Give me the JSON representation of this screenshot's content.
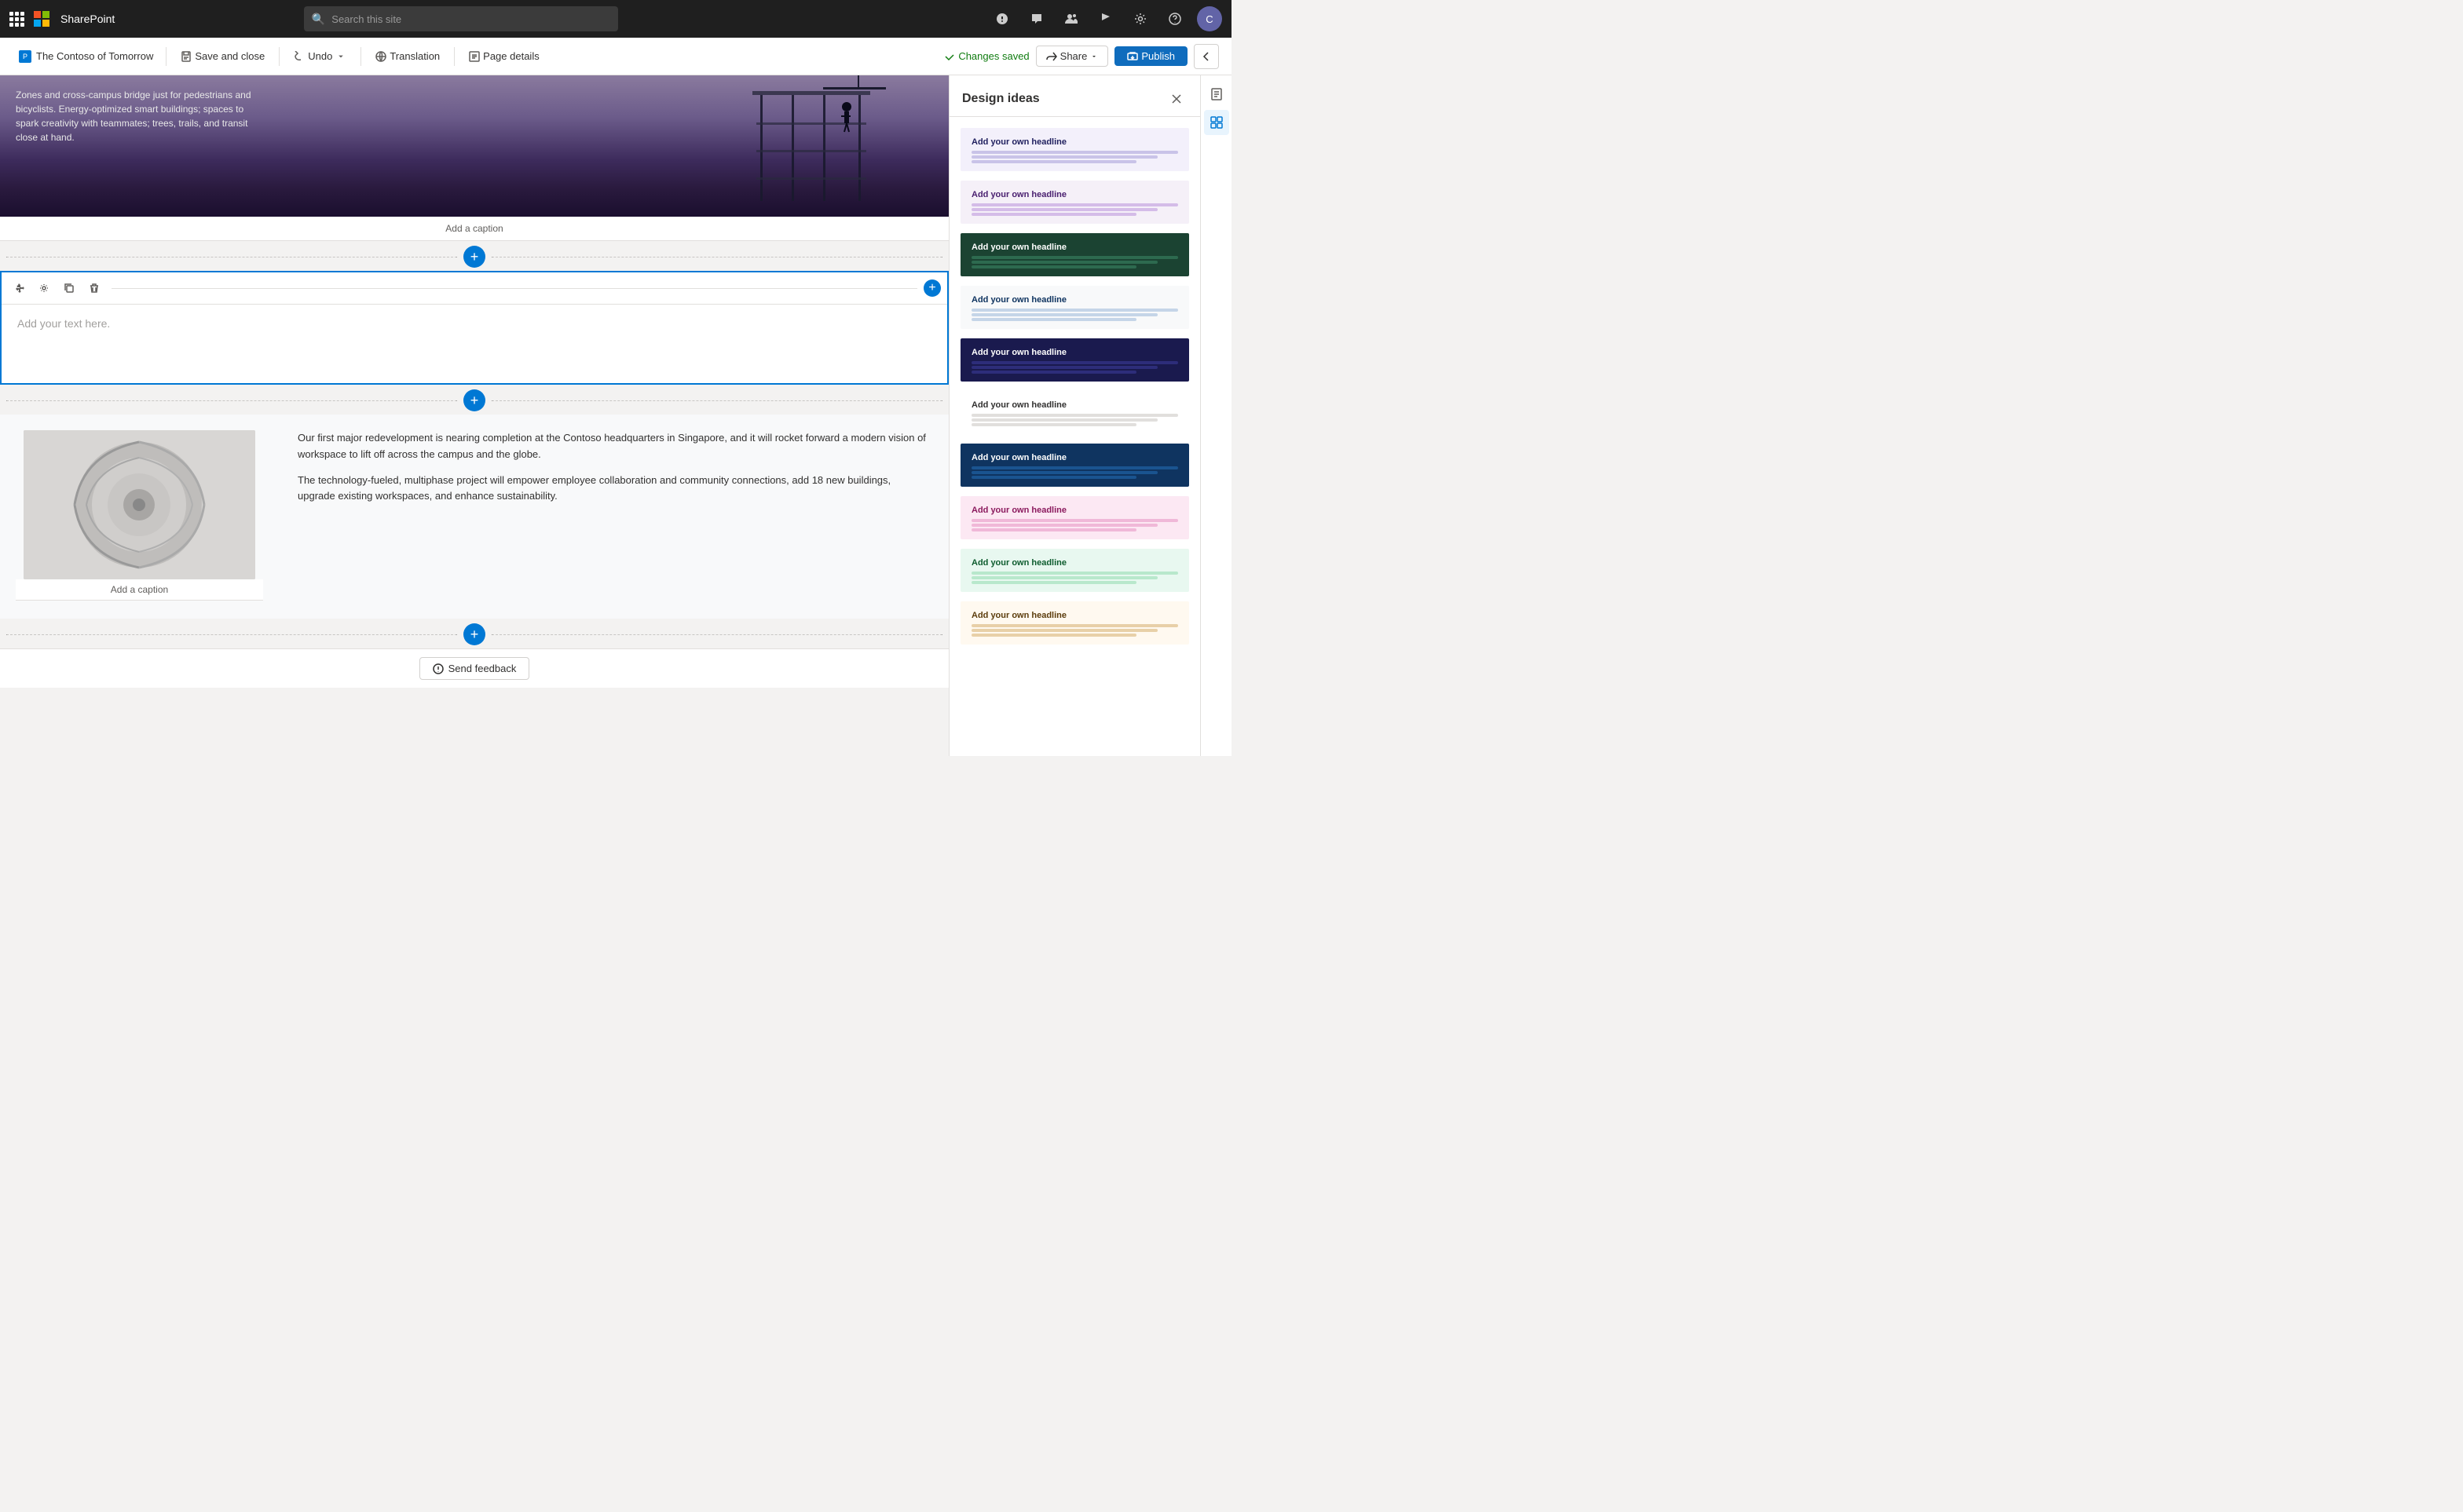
{
  "topbar": {
    "app_name": "SharePoint",
    "search_placeholder": "Search this site",
    "icons": [
      "grid-icon",
      "ms-logo",
      "share-icon",
      "comment-icon",
      "people-icon",
      "flag-icon",
      "settings-icon",
      "help-icon",
      "avatar"
    ]
  },
  "toolbar2": {
    "page_title": "The Contoso of Tomorrow",
    "save_close": "Save and close",
    "undo": "Undo",
    "translation": "Translation",
    "page_details": "Page details",
    "changes_saved": "Changes saved",
    "share": "Share",
    "publish": "Publish"
  },
  "hero": {
    "text": "Zones and cross-campus bridge just for pedestrians and bicyclists. Energy-optimized smart buildings; spaces to spark creativity with teammates; trees, trails, and transit close at hand.",
    "caption": "Add a caption"
  },
  "text_editor": {
    "placeholder": "Add your text here."
  },
  "two_col": {
    "image_caption": "Add a caption",
    "para1": "Our first major redevelopment is nearing completion at the Contoso headquarters in Singapore, and it will rocket forward a modern vision of workspace to lift off across the campus and the globe.",
    "para2": "The technology-fueled, multiphase project will empower employee collaboration and community connections, add 18 new buildings, upgrade existing workspaces, and enhance sustainability."
  },
  "design_panel": {
    "title": "Design ideas",
    "cards": [
      {
        "headline": "Add your own headline",
        "bg": "#f3f0fb",
        "headline_color": "#1f1f5e",
        "line_color": "#c9c3e8"
      },
      {
        "headline": "Add your own headline",
        "bg": "#f5f0f8",
        "headline_color": "#4a2070",
        "line_color": "#d4bce8"
      },
      {
        "headline": "Add your own headline",
        "bg": "#1b4332",
        "headline_color": "#ffffff",
        "line_color": "#2d6a4f"
      },
      {
        "headline": "Add your own headline",
        "bg": "#f8f9fa",
        "headline_color": "#0f3460",
        "line_color": "#c5d5e8"
      },
      {
        "headline": "Add your own headline",
        "bg": "#1a1a4e",
        "headline_color": "#ffffff",
        "line_color": "#2d2d7a"
      },
      {
        "headline": "Add your own headline",
        "bg": "#ffffff",
        "headline_color": "#323130",
        "line_color": "#e1dfdd"
      },
      {
        "headline": "Add your own headline",
        "bg": "#0f3460",
        "headline_color": "#ffffff",
        "line_color": "#1a5490"
      },
      {
        "headline": "Add your own headline",
        "bg": "#fce8f3",
        "headline_color": "#8b1a5e",
        "line_color": "#f0b8d8"
      },
      {
        "headline": "Add your own headline",
        "bg": "#e8f8f0",
        "headline_color": "#0d5c2e",
        "line_color": "#b8e8cc"
      },
      {
        "headline": "Add your own headline",
        "bg": "#fff9f0",
        "headline_color": "#5c3d0d",
        "line_color": "#e8d0a8"
      }
    ]
  },
  "feedback": {
    "label": "Send feedback"
  }
}
